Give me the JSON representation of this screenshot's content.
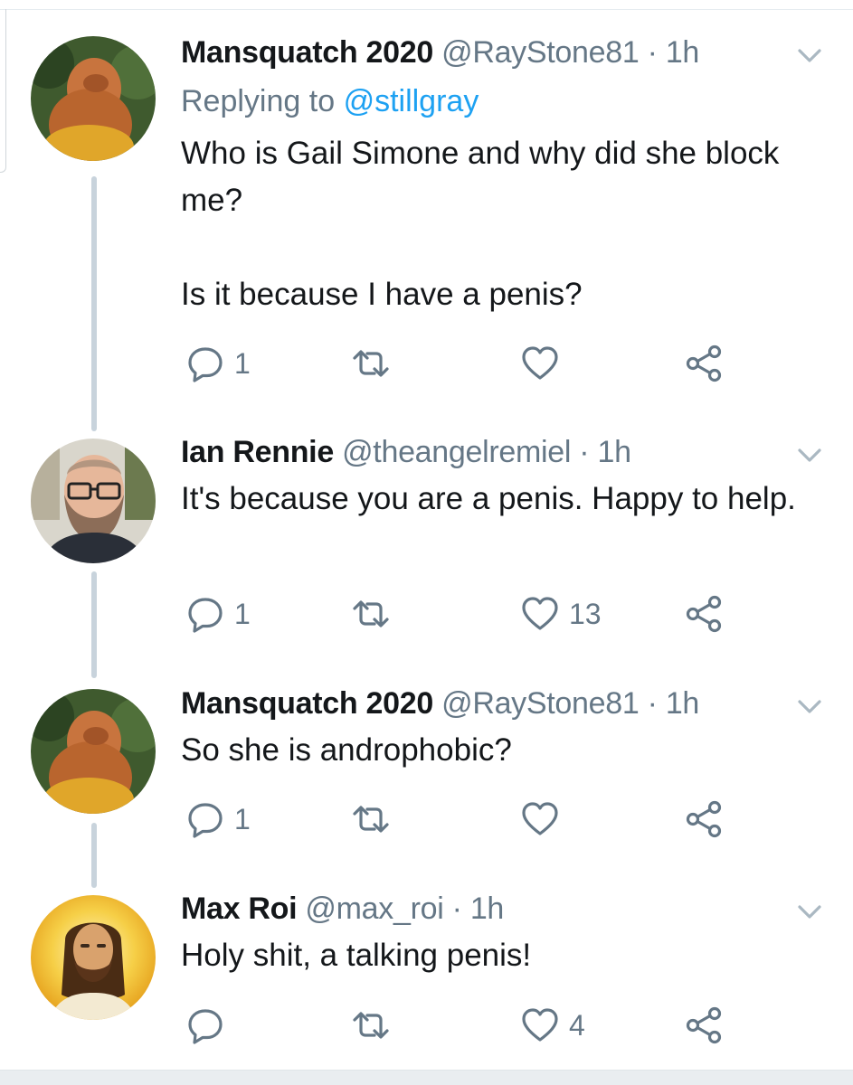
{
  "tweets": [
    {
      "display_name": "Mansquatch 2020",
      "handle": "@RayStone81",
      "dot": "·",
      "time": "1h",
      "replying_prefix": "Replying to",
      "replying_handle": "@stillgray",
      "text": "Who is Gail Simone and why did she block me?\n\nIs it because I have a penis?",
      "reply_count": "1",
      "retweet_count": "",
      "like_count": ""
    },
    {
      "display_name": "Ian Rennie",
      "handle": "@theangelremiel",
      "dot": "·",
      "time": "1h",
      "text": "It's because you are a penis. Happy to help.",
      "reply_count": "1",
      "retweet_count": "",
      "like_count": "13"
    },
    {
      "display_name": "Mansquatch 2020",
      "handle": "@RayStone81",
      "dot": "·",
      "time": "1h",
      "text": "So she is androphobic?",
      "reply_count": "1",
      "retweet_count": "",
      "like_count": ""
    },
    {
      "display_name": "Max Roi",
      "handle": "@max_roi",
      "dot": "·",
      "time": "1h",
      "text": "Holy shit, a talking penis!",
      "reply_count": "",
      "retweet_count": "",
      "like_count": "4"
    }
  ],
  "colors": {
    "text": "#14171a",
    "muted": "#657786",
    "link": "#1da1f2",
    "thread_line": "#c8d3dc"
  },
  "icons": [
    "reply-icon",
    "retweet-icon",
    "like-icon",
    "share-icon",
    "chevron-down-icon"
  ]
}
